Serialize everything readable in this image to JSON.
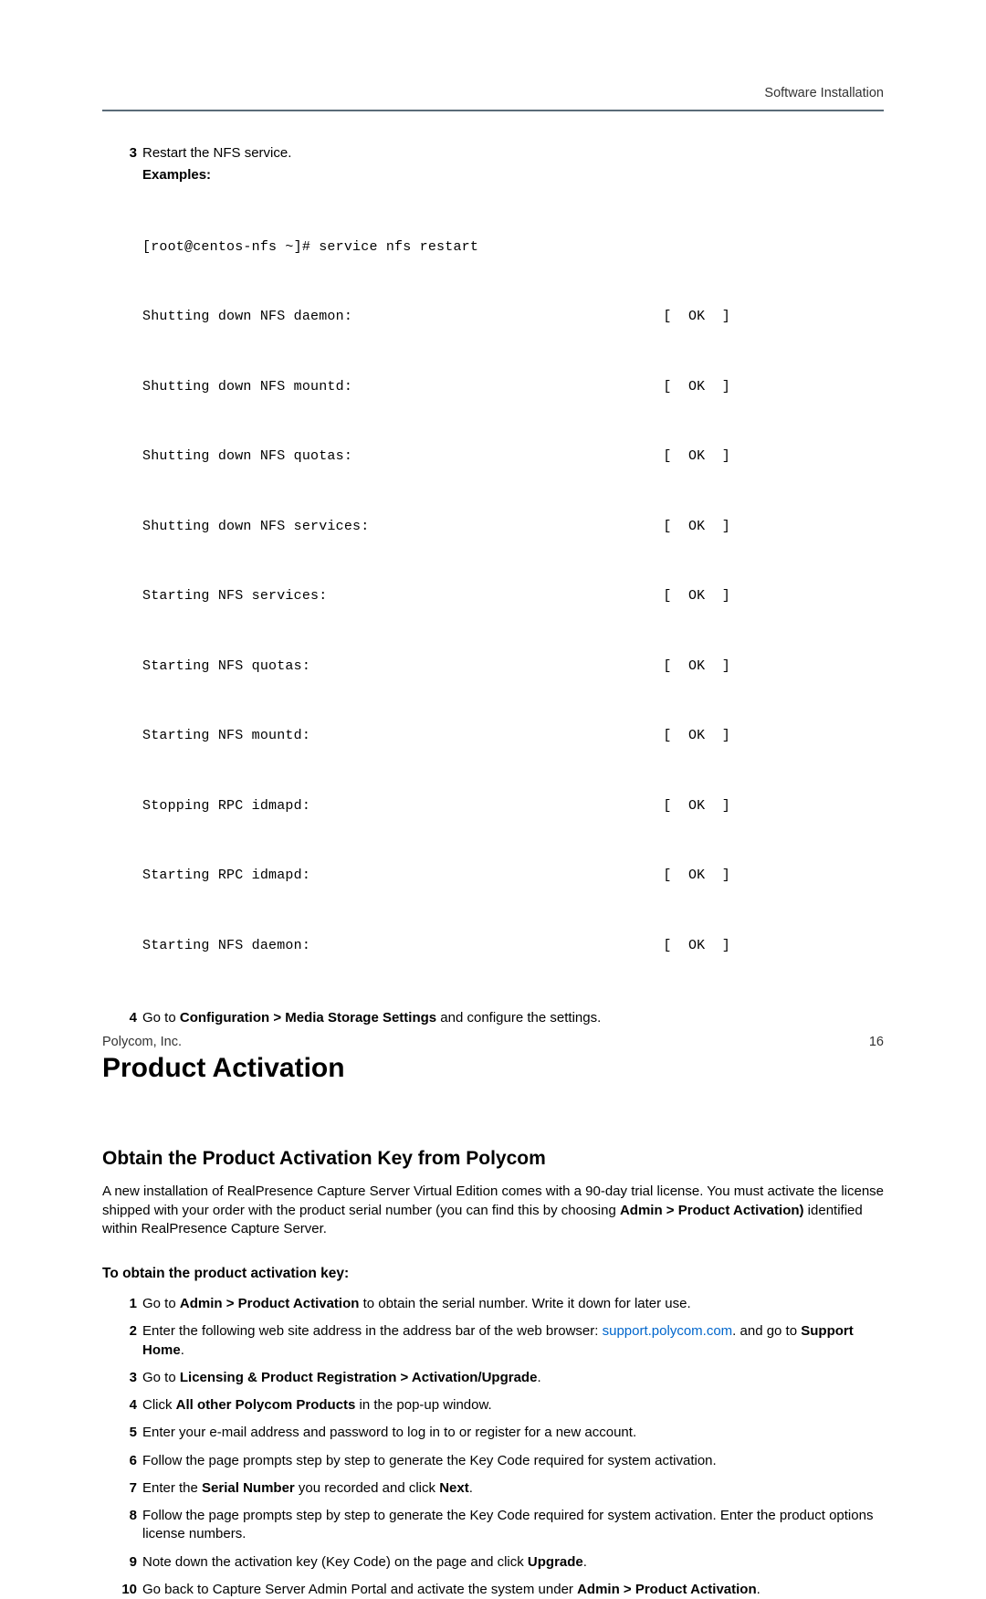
{
  "header": {
    "section": "Software Installation"
  },
  "step3": {
    "num": "3",
    "text": "Restart the NFS service.",
    "examples_label": "Examples:",
    "command": "[root@centos-nfs ~]# service nfs restart",
    "lines": [
      {
        "label": "Shutting down NFS daemon:",
        "status": "[  OK  ]"
      },
      {
        "label": "Shutting down NFS mountd:",
        "status": "[  OK  ]"
      },
      {
        "label": "Shutting down NFS quotas:",
        "status": "[  OK  ]"
      },
      {
        "label": "Shutting down NFS services:",
        "status": "[  OK  ]"
      },
      {
        "label": "Starting NFS services:",
        "status": "[  OK  ]"
      },
      {
        "label": "Starting NFS quotas:",
        "status": "[  OK  ]"
      },
      {
        "label": "Starting NFS mountd:",
        "status": "[  OK  ]"
      },
      {
        "label": "Stopping RPC idmapd:",
        "status": "[  OK  ]"
      },
      {
        "label": "Starting RPC idmapd:",
        "status": "[  OK  ]"
      },
      {
        "label": "Starting NFS daemon:",
        "status": "[  OK  ]"
      }
    ]
  },
  "step4": {
    "num": "4",
    "pre": "Go to ",
    "bold": "Configuration > Media Storage Settings",
    "post": " and configure the settings."
  },
  "h1": "Product Activation",
  "h2": "Obtain the Product Activation Key from Polycom",
  "para": {
    "pre": "A new installation of RealPresence Capture Server Virtual Edition comes with a 90-day trial license. You must activate the license shipped with your order with the product serial number (you can find this by choosing ",
    "bold": "Admin > Product Activation)",
    "post": " identified within RealPresence Capture Server."
  },
  "subtitle": "To obtain the product activation key:",
  "steps": {
    "s1": {
      "num": "1",
      "pre": "Go to ",
      "b1": "Admin > Product Activation",
      "post": " to obtain the serial number. Write it down for later use."
    },
    "s2": {
      "num": "2",
      "pre": "Enter the following web site address in the address bar of the web browser: ",
      "link": "support.polycom.com",
      "post1": ". and go to ",
      "b1": "Support Home",
      "post2": "."
    },
    "s3": {
      "num": "3",
      "pre": "Go to ",
      "b1": "Licensing & Product Registration > Activation/Upgrade",
      "post": "."
    },
    "s4": {
      "num": "4",
      "pre": "Click ",
      "b1": "All other Polycom Products",
      "post": " in the pop-up window."
    },
    "s5": {
      "num": "5",
      "text": "Enter your e-mail address and password to log in to or register for a new account."
    },
    "s6": {
      "num": "6",
      "text": "Follow the page prompts step by step to generate the Key Code required for system activation."
    },
    "s7": {
      "num": "7",
      "pre": "Enter the ",
      "b1": "Serial Number",
      "mid": " you recorded and click ",
      "b2": "Next",
      "post": "."
    },
    "s8": {
      "num": "8",
      "text": "Follow the page prompts step by step to generate the Key Code required for system activation. Enter the product options license numbers."
    },
    "s9": {
      "num": "9",
      "pre": "Note down the activation key (Key Code) on the page and click ",
      "b1": "Upgrade",
      "post": "."
    },
    "s10": {
      "num": "10",
      "pre": "Go back to Capture Server Admin Portal and activate the system under ",
      "b1": "Admin > Product Activation",
      "post": "."
    }
  },
  "footer": {
    "left": "Polycom, Inc.",
    "right": "16"
  }
}
